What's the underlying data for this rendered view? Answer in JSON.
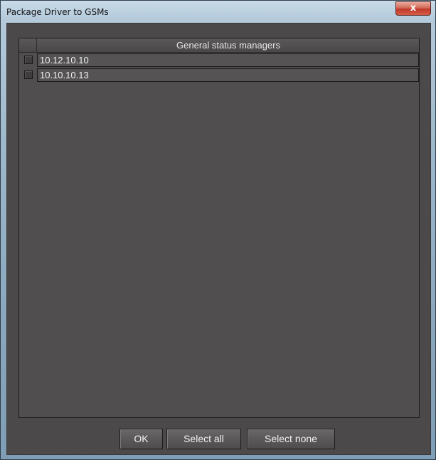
{
  "window": {
    "title": "Package Driver to GSMs",
    "close_label": "x"
  },
  "list": {
    "column_header": "General status managers",
    "rows": [
      {
        "checked": false,
        "value": "10.12.10.10"
      },
      {
        "checked": false,
        "value": "10.10.10.13"
      }
    ]
  },
  "buttons": {
    "ok": "OK",
    "select_all": "Select all",
    "select_none": "Select none"
  },
  "colors": {
    "background": "#4b4949",
    "list_background": "#504e4e",
    "text": "#f0f0f0",
    "close_button": "#c0392b"
  }
}
